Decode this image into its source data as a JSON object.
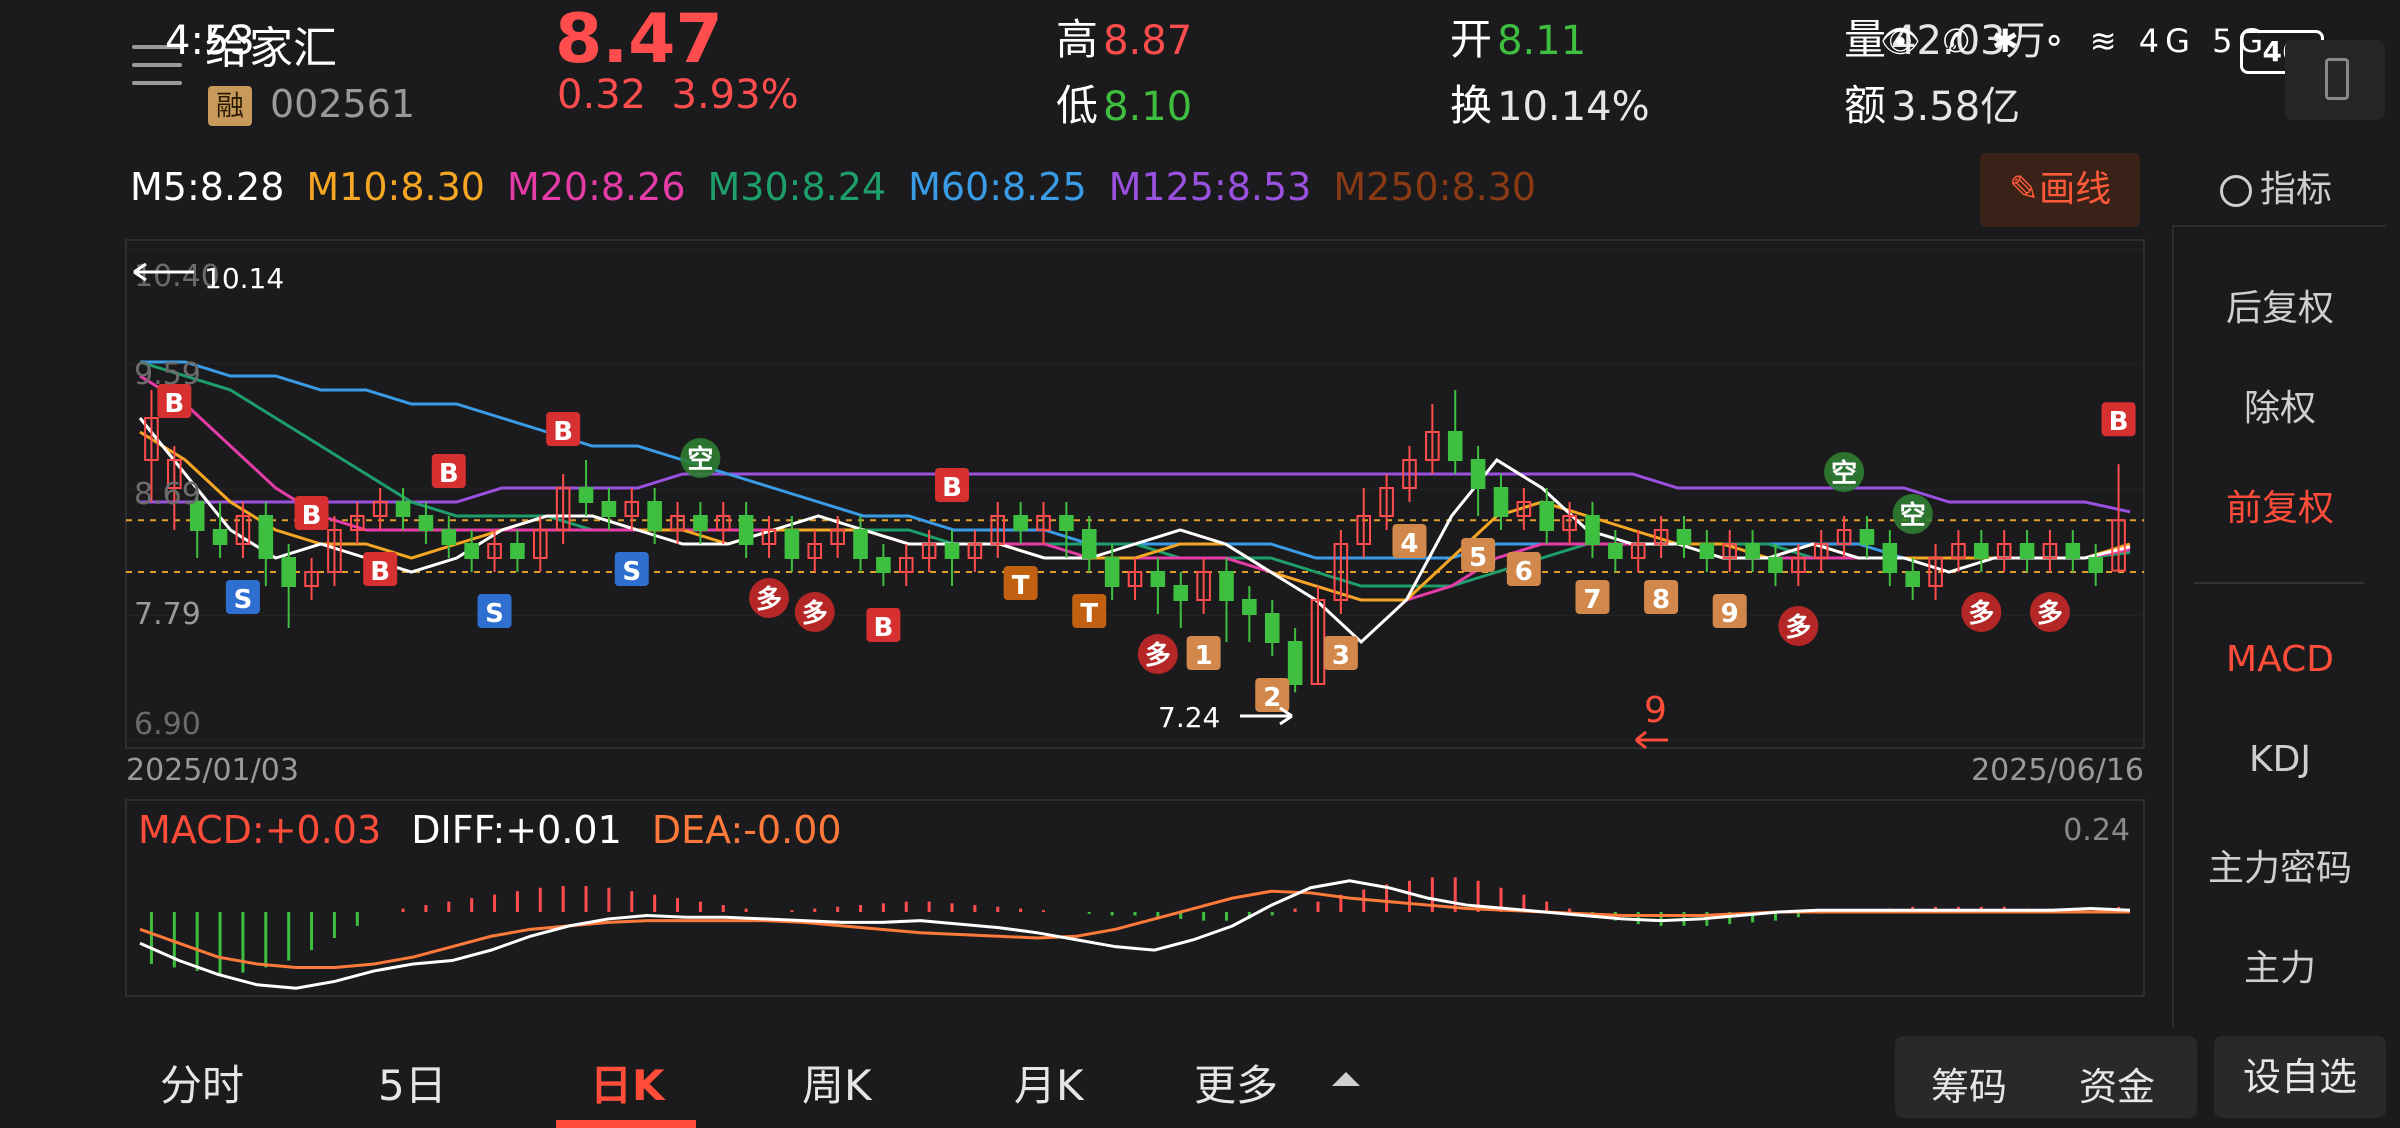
{
  "header": {
    "status_time": "4:53",
    "name": "给家汇",
    "badge": "融",
    "code": "002561",
    "price": "8.47",
    "change": "0.32",
    "change_pct": "3.93%",
    "high_label": "高",
    "high": "8.87",
    "low_label": "低",
    "low": "8.10",
    "open_label": "开",
    "open": "8.11",
    "turnover_label": "换",
    "turnover": "10.14%",
    "volume_label": "量",
    "volume": "42.03万",
    "amount_label": "额",
    "amount": "3.58亿",
    "battery": "46",
    "status_icons": "👁 ✆ ✱ ⚬ ≋ 4G 5G"
  },
  "ma_legend": [
    {
      "label": "M5:8.28",
      "color": "#ffffff"
    },
    {
      "label": "M10:8.30",
      "color": "#f5a623"
    },
    {
      "label": "M20:8.26",
      "color": "#e63ca8"
    },
    {
      "label": "M30:8.24",
      "color": "#1e9e6a"
    },
    {
      "label": "M60:8.25",
      "color": "#3a9be6"
    },
    {
      "label": "M125:8.53",
      "color": "#9b51e0"
    },
    {
      "label": "M250:8.30",
      "color": "#8a3a14"
    }
  ],
  "toolbar": {
    "draw_label": "✎画线",
    "indicator_label": "指标"
  },
  "sidebar": {
    "items": [
      {
        "label": "后复权",
        "active": false
      },
      {
        "label": "除权",
        "active": false
      },
      {
        "label": "前复权",
        "active": true
      },
      {
        "label": "MACD",
        "active": true
      },
      {
        "label": "KDJ",
        "active": false
      },
      {
        "label": "主力密码",
        "active": false
      },
      {
        "label": "主力",
        "active": false
      }
    ]
  },
  "chart_data": [
    {
      "type": "candlestick",
      "ylim": [
        6.9,
        10.4
      ],
      "y_ticks": [
        "10.40",
        "9.59",
        "8.69",
        "7.79",
        "6.90"
      ],
      "x_start": "2025/01/03",
      "x_end": "2025/06/16",
      "max_label": "10.14",
      "min_label": "7.24",
      "dashed_levels": [
        8.47,
        8.1
      ],
      "x_axis_marker": "9",
      "markers": [
        "B",
        "S",
        "B",
        "B",
        "B",
        "S",
        "B",
        "S",
        "空",
        "多",
        "多",
        "B",
        "B",
        "T",
        "T",
        "多",
        "1",
        "2",
        "3",
        "4",
        "5",
        "6",
        "7",
        "8",
        "9",
        "多",
        "空",
        "空",
        "多",
        "多",
        "B"
      ],
      "candles": [
        [
          8.9,
          9.2,
          8.6,
          9.4
        ],
        [
          8.7,
          8.9,
          8.4,
          9.0
        ],
        [
          8.6,
          8.4,
          8.2,
          8.7
        ],
        [
          8.4,
          8.3,
          8.2,
          8.6
        ],
        [
          8.3,
          8.5,
          8.2,
          8.6
        ],
        [
          8.5,
          8.2,
          8.0,
          8.6
        ],
        [
          8.2,
          8.0,
          7.7,
          8.3
        ],
        [
          8.0,
          8.1,
          7.9,
          8.2
        ],
        [
          8.1,
          8.4,
          8.0,
          8.5
        ],
        [
          8.4,
          8.5,
          8.3,
          8.6
        ],
        [
          8.5,
          8.6,
          8.4,
          8.7
        ],
        [
          8.6,
          8.5,
          8.4,
          8.7
        ],
        [
          8.5,
          8.4,
          8.3,
          8.6
        ],
        [
          8.4,
          8.3,
          8.2,
          8.5
        ],
        [
          8.3,
          8.2,
          8.1,
          8.4
        ],
        [
          8.2,
          8.3,
          8.1,
          8.4
        ],
        [
          8.3,
          8.2,
          8.1,
          8.4
        ],
        [
          8.2,
          8.4,
          8.1,
          8.5
        ],
        [
          8.4,
          8.7,
          8.3,
          8.8
        ],
        [
          8.7,
          8.6,
          8.5,
          8.9
        ],
        [
          8.6,
          8.5,
          8.4,
          8.7
        ],
        [
          8.5,
          8.6,
          8.4,
          8.7
        ],
        [
          8.6,
          8.4,
          8.3,
          8.7
        ],
        [
          8.4,
          8.5,
          8.3,
          8.6
        ],
        [
          8.5,
          8.4,
          8.3,
          8.6
        ],
        [
          8.4,
          8.5,
          8.3,
          8.6
        ],
        [
          8.5,
          8.3,
          8.2,
          8.6
        ],
        [
          8.3,
          8.4,
          8.2,
          8.5
        ],
        [
          8.4,
          8.2,
          8.1,
          8.5
        ],
        [
          8.2,
          8.3,
          8.1,
          8.4
        ],
        [
          8.3,
          8.4,
          8.2,
          8.5
        ],
        [
          8.4,
          8.2,
          8.1,
          8.5
        ],
        [
          8.2,
          8.1,
          8.0,
          8.3
        ],
        [
          8.1,
          8.2,
          8.0,
          8.3
        ],
        [
          8.2,
          8.3,
          8.1,
          8.4
        ],
        [
          8.3,
          8.2,
          8.0,
          8.4
        ],
        [
          8.2,
          8.3,
          8.1,
          8.4
        ],
        [
          8.3,
          8.5,
          8.2,
          8.6
        ],
        [
          8.5,
          8.4,
          8.3,
          8.6
        ],
        [
          8.4,
          8.5,
          8.3,
          8.6
        ],
        [
          8.5,
          8.4,
          8.2,
          8.6
        ],
        [
          8.4,
          8.2,
          8.1,
          8.5
        ],
        [
          8.2,
          8.0,
          7.9,
          8.3
        ],
        [
          8.0,
          8.1,
          7.9,
          8.2
        ],
        [
          8.1,
          8.0,
          7.8,
          8.2
        ],
        [
          8.0,
          7.9,
          7.7,
          8.1
        ],
        [
          7.9,
          8.1,
          7.8,
          8.2
        ],
        [
          8.1,
          7.9,
          7.6,
          8.2
        ],
        [
          7.9,
          7.8,
          7.6,
          8.0
        ],
        [
          7.8,
          7.6,
          7.5,
          7.9
        ],
        [
          7.6,
          7.3,
          7.24,
          7.7
        ],
        [
          7.3,
          7.9,
          7.3,
          8.0
        ],
        [
          7.9,
          8.3,
          7.8,
          8.4
        ],
        [
          8.3,
          8.5,
          8.2,
          8.7
        ],
        [
          8.5,
          8.7,
          8.4,
          8.8
        ],
        [
          8.7,
          8.9,
          8.6,
          9.0
        ],
        [
          8.9,
          9.1,
          8.8,
          9.3
        ],
        [
          9.1,
          8.9,
          8.8,
          9.4
        ],
        [
          8.9,
          8.7,
          8.5,
          9.0
        ],
        [
          8.7,
          8.5,
          8.4,
          8.8
        ],
        [
          8.5,
          8.6,
          8.4,
          8.7
        ],
        [
          8.6,
          8.4,
          8.3,
          8.7
        ],
        [
          8.4,
          8.5,
          8.3,
          8.6
        ],
        [
          8.5,
          8.3,
          8.2,
          8.6
        ],
        [
          8.3,
          8.2,
          8.1,
          8.4
        ],
        [
          8.2,
          8.3,
          8.1,
          8.4
        ],
        [
          8.3,
          8.4,
          8.2,
          8.5
        ],
        [
          8.4,
          8.3,
          8.2,
          8.5
        ],
        [
          8.3,
          8.2,
          8.1,
          8.4
        ],
        [
          8.2,
          8.3,
          8.1,
          8.4
        ],
        [
          8.3,
          8.2,
          8.1,
          8.4
        ],
        [
          8.2,
          8.1,
          8.0,
          8.3
        ],
        [
          8.1,
          8.2,
          8.0,
          8.3
        ],
        [
          8.2,
          8.3,
          8.1,
          8.4
        ],
        [
          8.3,
          8.4,
          8.2,
          8.5
        ],
        [
          8.4,
          8.3,
          8.2,
          8.5
        ],
        [
          8.3,
          8.1,
          8.0,
          8.4
        ],
        [
          8.1,
          8.0,
          7.9,
          8.2
        ],
        [
          8.0,
          8.2,
          7.9,
          8.3
        ],
        [
          8.2,
          8.3,
          8.1,
          8.4
        ],
        [
          8.3,
          8.2,
          8.1,
          8.4
        ],
        [
          8.2,
          8.3,
          8.1,
          8.4
        ],
        [
          8.3,
          8.2,
          8.1,
          8.4
        ],
        [
          8.2,
          8.3,
          8.1,
          8.4
        ],
        [
          8.3,
          8.2,
          8.1,
          8.4
        ],
        [
          8.2,
          8.1,
          8.0,
          8.3
        ],
        [
          8.11,
          8.47,
          8.1,
          8.87
        ]
      ],
      "ma5": [
        9.2,
        8.8,
        8.4,
        8.2,
        8.3,
        8.2,
        8.1,
        8.2,
        8.4,
        8.5,
        8.5,
        8.4,
        8.3,
        8.3,
        8.4,
        8.5,
        8.4,
        8.3,
        8.3,
        8.3,
        8.2,
        8.2,
        8.3,
        8.4,
        8.3,
        8.1,
        7.9,
        7.6,
        7.9,
        8.5,
        8.9,
        8.7,
        8.4,
        8.3,
        8.3,
        8.2,
        8.2,
        8.3,
        8.2,
        8.2,
        8.1,
        8.2,
        8.2,
        8.2,
        8.28
      ],
      "ma10": [
        9.1,
        8.9,
        8.6,
        8.4,
        8.3,
        8.3,
        8.2,
        8.3,
        8.4,
        8.5,
        8.5,
        8.4,
        8.4,
        8.3,
        8.4,
        8.4,
        8.4,
        8.3,
        8.3,
        8.3,
        8.2,
        8.2,
        8.2,
        8.3,
        8.3,
        8.1,
        8.0,
        7.9,
        7.9,
        8.2,
        8.5,
        8.6,
        8.5,
        8.4,
        8.3,
        8.3,
        8.2,
        8.3,
        8.2,
        8.2,
        8.2,
        8.2,
        8.2,
        8.2,
        8.3
      ],
      "ma20": [
        9.5,
        9.3,
        9.0,
        8.7,
        8.5,
        8.4,
        8.4,
        8.4,
        8.4,
        8.4,
        8.4,
        8.4,
        8.4,
        8.4,
        8.4,
        8.4,
        8.4,
        8.3,
        8.3,
        8.3,
        8.3,
        8.2,
        8.2,
        8.2,
        8.2,
        8.1,
        8.0,
        7.9,
        7.9,
        8.0,
        8.2,
        8.3,
        8.3,
        8.3,
        8.3,
        8.3,
        8.2,
        8.2,
        8.2,
        8.2,
        8.2,
        8.2,
        8.2,
        8.2,
        8.26
      ],
      "ma30": [
        9.6,
        9.5,
        9.4,
        9.2,
        9.0,
        8.8,
        8.6,
        8.5,
        8.5,
        8.5,
        8.4,
        8.4,
        8.4,
        8.4,
        8.4,
        8.4,
        8.4,
        8.4,
        8.3,
        8.3,
        8.3,
        8.3,
        8.3,
        8.2,
        8.2,
        8.2,
        8.1,
        8.0,
        8.0,
        8.0,
        8.1,
        8.2,
        8.3,
        8.3,
        8.3,
        8.3,
        8.3,
        8.2,
        8.2,
        8.2,
        8.2,
        8.2,
        8.2,
        8.2,
        8.24
      ],
      "ma60": [
        9.6,
        9.6,
        9.5,
        9.5,
        9.4,
        9.4,
        9.3,
        9.3,
        9.2,
        9.1,
        9.0,
        9.0,
        8.9,
        8.8,
        8.7,
        8.6,
        8.5,
        8.5,
        8.4,
        8.4,
        8.4,
        8.3,
        8.3,
        8.3,
        8.3,
        8.3,
        8.2,
        8.2,
        8.2,
        8.2,
        8.3,
        8.3,
        8.3,
        8.3,
        8.3,
        8.3,
        8.3,
        8.3,
        8.3,
        8.2,
        8.2,
        8.2,
        8.2,
        8.2,
        8.25
      ],
      "ma125": [
        8.6,
        8.6,
        8.6,
        8.6,
        8.6,
        8.6,
        8.6,
        8.6,
        8.7,
        8.7,
        8.7,
        8.7,
        8.8,
        8.8,
        8.8,
        8.8,
        8.8,
        8.8,
        8.8,
        8.8,
        8.8,
        8.8,
        8.8,
        8.8,
        8.8,
        8.8,
        8.8,
        8.8,
        8.8,
        8.8,
        8.8,
        8.8,
        8.8,
        8.8,
        8.7,
        8.7,
        8.7,
        8.7,
        8.7,
        8.7,
        8.6,
        8.6,
        8.6,
        8.6,
        8.53
      ]
    },
    {
      "type": "macd",
      "title": "MACD",
      "macd_label": "MACD:+0.03",
      "diff_label": "DIFF:+0.01",
      "dea_label": "DEA:-0.00",
      "y_max_label": "0.24",
      "ylim": [
        -0.45,
        0.3
      ],
      "hist": [
        -0.3,
        -0.32,
        -0.34,
        -0.36,
        -0.35,
        -0.32,
        -0.28,
        -0.22,
        -0.15,
        -0.08,
        0.0,
        0.02,
        0.04,
        0.06,
        0.08,
        0.1,
        0.12,
        0.14,
        0.15,
        0.15,
        0.14,
        0.12,
        0.1,
        0.08,
        0.06,
        0.04,
        0.02,
        0.0,
        0.01,
        0.02,
        0.03,
        0.04,
        0.05,
        0.06,
        0.06,
        0.05,
        0.04,
        0.03,
        0.02,
        0.01,
        0.0,
        -0.01,
        -0.02,
        -0.02,
        -0.03,
        -0.04,
        -0.05,
        -0.05,
        -0.04,
        -0.02,
        0.02,
        0.06,
        0.1,
        0.13,
        0.16,
        0.18,
        0.2,
        0.2,
        0.18,
        0.14,
        0.1,
        0.06,
        0.02,
        -0.02,
        -0.05,
        -0.07,
        -0.08,
        -0.08,
        -0.08,
        -0.07,
        -0.06,
        -0.05,
        -0.03,
        -0.01,
        0.0,
        0.01,
        0.02,
        0.03,
        0.03,
        0.03,
        0.03,
        0.03,
        0.02,
        0.02,
        0.02,
        0.02,
        0.03
      ],
      "diff": [
        -0.18,
        -0.28,
        -0.36,
        -0.42,
        -0.44,
        -0.4,
        -0.34,
        -0.3,
        -0.28,
        -0.22,
        -0.14,
        -0.08,
        -0.04,
        -0.02,
        -0.03,
        -0.03,
        -0.04,
        -0.05,
        -0.06,
        -0.06,
        -0.05,
        -0.07,
        -0.09,
        -0.12,
        -0.16,
        -0.2,
        -0.22,
        -0.16,
        -0.08,
        0.04,
        0.14,
        0.18,
        0.14,
        0.08,
        0.04,
        0.02,
        0.0,
        -0.02,
        -0.04,
        -0.05,
        -0.04,
        -0.02,
        0.0,
        0.01,
        0.01,
        0.01,
        0.01,
        0.01,
        0.01,
        0.01,
        0.02,
        0.01
      ],
      "dea": [
        -0.1,
        -0.18,
        -0.26,
        -0.3,
        -0.32,
        -0.32,
        -0.3,
        -0.26,
        -0.2,
        -0.14,
        -0.1,
        -0.08,
        -0.06,
        -0.05,
        -0.05,
        -0.05,
        -0.05,
        -0.06,
        -0.08,
        -0.1,
        -0.12,
        -0.13,
        -0.14,
        -0.15,
        -0.14,
        -0.1,
        -0.04,
        0.02,
        0.08,
        0.12,
        0.11,
        0.08,
        0.06,
        0.04,
        0.02,
        0.01,
        0.0,
        -0.01,
        -0.02,
        -0.02,
        -0.02,
        -0.01,
        0.0,
        0.0,
        0.0,
        0.0,
        0.0,
        0.0,
        0.0,
        0.0,
        0.0,
        0.0
      ]
    }
  ],
  "tabs": [
    {
      "label": "分时",
      "active": false
    },
    {
      "label": "5日",
      "active": false
    },
    {
      "label": "日K",
      "active": true
    },
    {
      "label": "周K",
      "active": false
    },
    {
      "label": "月K",
      "active": false
    },
    {
      "label": "更多",
      "active": false
    }
  ],
  "bottom_buttons": {
    "chips": "筹码",
    "funds": "资金",
    "add_watch": "设自选"
  },
  "colors": {
    "up": "#ff4d4d",
    "down": "#3fbf3f",
    "accent": "#ff4d3a",
    "bg": "#1b1b1d"
  }
}
